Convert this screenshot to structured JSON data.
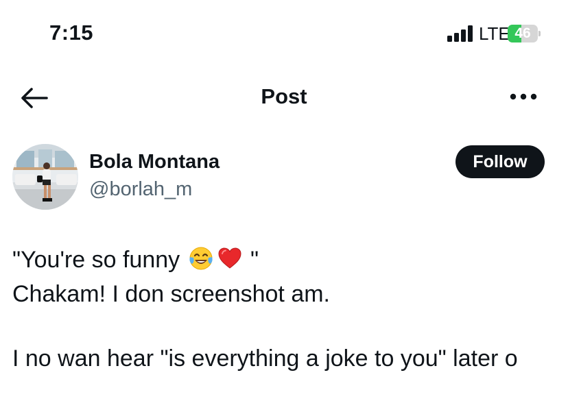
{
  "status_bar": {
    "time": "7:15",
    "network": "LTE",
    "battery_level": "46",
    "battery_fraction": 0.46,
    "battery_color": "#34c759"
  },
  "header": {
    "title": "Post",
    "back_icon": "arrow-left-icon",
    "more_icon": "more-horizontal-icon"
  },
  "author": {
    "name": "Bola Montana",
    "handle": "@borlah_m",
    "follow_label": "Follow"
  },
  "tweet": {
    "line1_text": "\"You're so funny ",
    "line1_suffix": " \"",
    "line1_emojis": [
      "face-with-tears-of-joy-emoji",
      "red-heart-emoji"
    ],
    "line2": "Chakam! I don screenshot am.",
    "line3": "I no wan hear \"is everything a joke to you\" later o"
  }
}
